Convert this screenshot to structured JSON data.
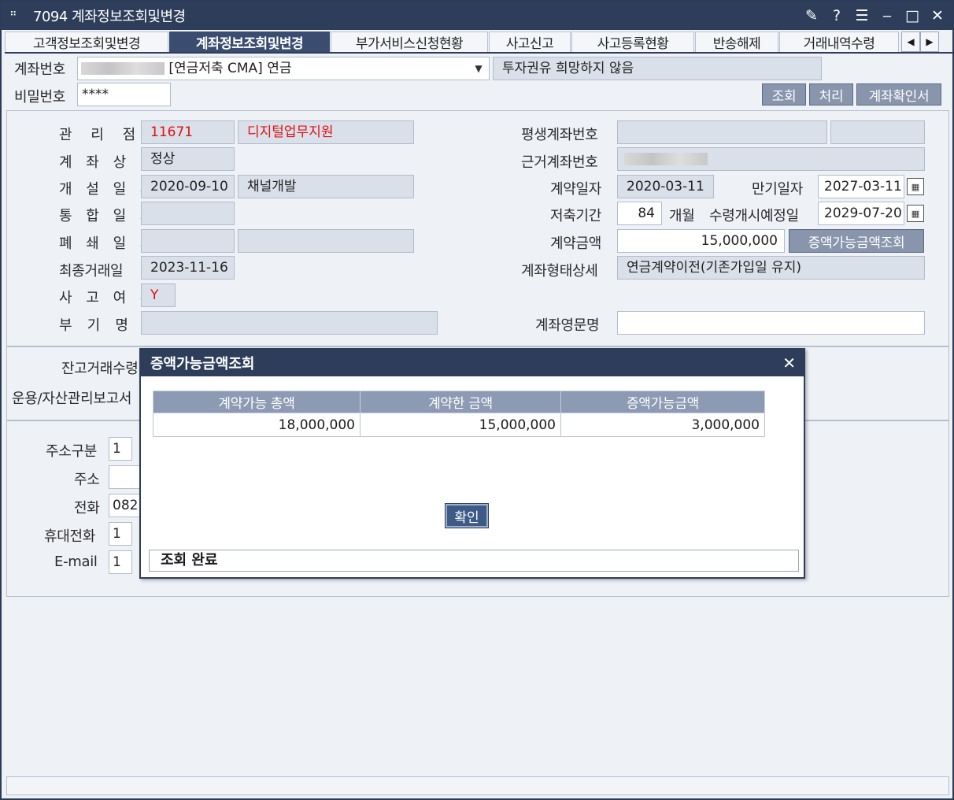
{
  "window": {
    "title": "7094 계좌정보조회및변경"
  },
  "tabs": [
    {
      "label": "고객정보조회및변경"
    },
    {
      "label": "계좌정보조회및변경"
    },
    {
      "label": "부가서비스신청현황"
    },
    {
      "label": "사고신고"
    },
    {
      "label": "사고등록현황"
    },
    {
      "label": "반송해제"
    },
    {
      "label": "거래내역수령"
    }
  ],
  "top": {
    "account_label": "계좌번호",
    "account_value": "[연금저축 CMA] 연금",
    "invest_notice": "투자권유 희망하지 않음",
    "password_label": "비밀번호",
    "password_value": "****",
    "btn_query": "조회",
    "btn_process": "처리",
    "btn_confirm": "계좌확인서"
  },
  "left": {
    "branch_label": "관 리 점",
    "branch_code": "11671",
    "branch_name": "디지털업무지원",
    "status_label": "계 좌 상 태",
    "status_value": "정상",
    "open_label": "개 설 일 자",
    "open_date": "2020-09-10",
    "open_channel": "채널개발",
    "merge_label": "통 합 일 자",
    "close_label": "폐 쇄 일 자",
    "last_trade_label": "최종거래일",
    "last_trade_date": "2023-11-16",
    "incident_label": "사 고 여 부",
    "incident_value": "Y",
    "sub_name_label": "부  기  명"
  },
  "right": {
    "lifetime_label": "평생계좌번호",
    "base_label": "근거계좌번호",
    "contract_date_label": "계약일자",
    "contract_date": "2020-03-11",
    "maturity_label": "만기일자",
    "maturity_date": "2027-03-11",
    "saving_label": "저축기간",
    "saving_months": "84",
    "months_unit": "개월",
    "payout_label": "수령개시예정일",
    "payout_date": "2029-07-20",
    "contract_amt_label": "계약금액",
    "contract_amt": "15,000,000",
    "btn_increase": "증액가능금액조회",
    "type_label": "계좌형태상세",
    "type_value": "연금계약이전(기존가입일 유지)",
    "eng_name_label": "계좌영문명"
  },
  "middle": {
    "balance_label": "잔고거래수령",
    "report_label": "운용/자산관리보고서"
  },
  "contact": {
    "addr_type_label": "주소구분",
    "addr_type_value": "1",
    "addr_label": "주소",
    "phone_label": "전화",
    "phone_value": "082",
    "mobile_label": "휴대전화",
    "mobile_value": "1",
    "email_label": "E-mail",
    "email_value": "1"
  },
  "dialog": {
    "title": "증액가능금액조회",
    "columns": [
      "계약가능 총액",
      "계약한 금액",
      "증액가능금액"
    ],
    "row": [
      "18,000,000",
      "15,000,000",
      "3,000,000"
    ],
    "ok": "확인",
    "status": "조회 완료"
  },
  "colors": {
    "titlebar": "#2e3d5a",
    "button": "#8895ad",
    "red_text": "#e01010"
  }
}
